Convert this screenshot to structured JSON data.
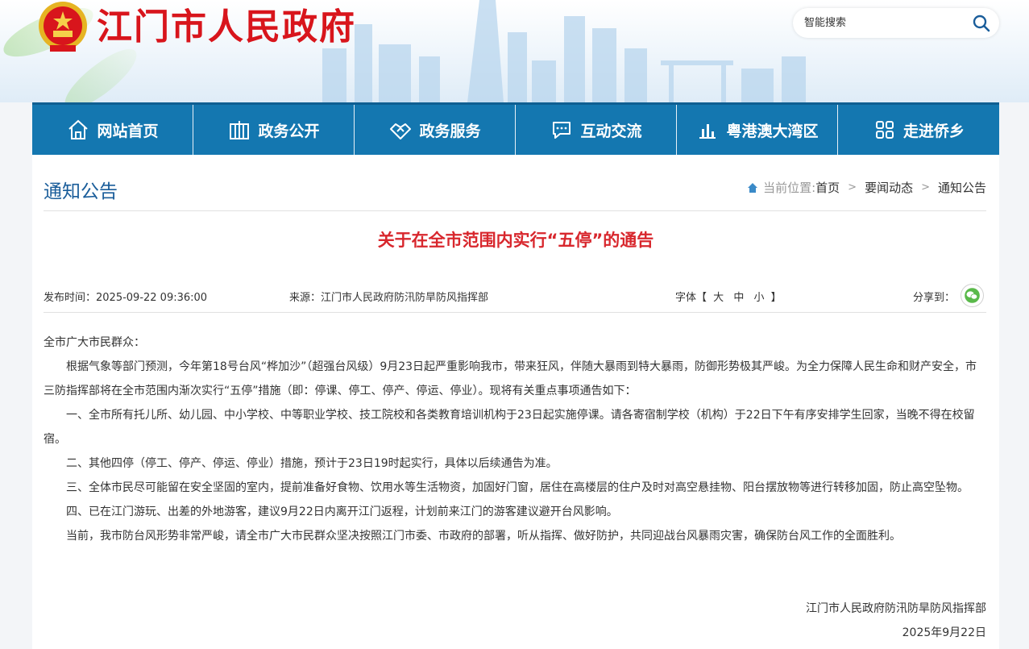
{
  "header": {
    "site_title": "江门市人民政府",
    "search_placeholder": "智能搜索"
  },
  "nav": {
    "items": [
      {
        "label": "网站首页",
        "icon": "home-icon"
      },
      {
        "label": "政务公开",
        "icon": "building-icon"
      },
      {
        "label": "政务服务",
        "icon": "handshake-icon"
      },
      {
        "label": "互动交流",
        "icon": "chat-icon"
      },
      {
        "label": "粤港澳大湾区",
        "icon": "bar-chart-icon"
      },
      {
        "label": "走进侨乡",
        "icon": "grid-icon"
      }
    ]
  },
  "page": {
    "section_title": "通知公告",
    "breadcrumb": {
      "label": "当前位置:",
      "items": [
        "首页",
        "要闻动态",
        "通知公告"
      ],
      "separator": ">"
    }
  },
  "article": {
    "title": "关于在全市范围内实行“五停”的通告",
    "publish_time": "发布时间：2025-09-22 09:36:00",
    "source": "来源：江门市人民政府防汛防旱防风指挥部",
    "font_label": "字体【",
    "font_sizes": [
      "大",
      "中",
      "小"
    ],
    "font_close": "】",
    "share_label": "分享到：",
    "paragraphs": [
      "全市广大市民群众：",
      "根据气象等部门预测，今年第18号台风“桦加沙”（超强台风级）9月23日起严重影响我市，带来狂风，伴随大暴雨到特大暴雨，防御形势极其严峻。为全力保障人民生命和财产安全，市三防指挥部将在全市范围内渐次实行“五停”措施（即：停课、停工、停产、停运、停业）。现将有关重点事项通告如下：",
      "一、全市所有托儿所、幼儿园、中小学校、中等职业学校、技工院校和各类教育培训机构于23日起实施停课。请各寄宿制学校（机构）于22日下午有序安排学生回家，当晚不得在校留宿。",
      "二、其他四停（停工、停产、停运、停业）措施，预计于23日19时起实行，具体以后续通告为准。",
      "三、全体市民尽可能留在安全坚固的室内，提前准备好食物、饮用水等生活物资，加固好门窗，居住在高楼层的住户及时对高空悬挂物、阳台摆放物等进行转移加固，防止高空坠物。",
      "四、已在江门游玩、出差的外地游客，建议9月22日内离开江门返程，计划前来江门的游客建议避开台风影响。",
      "当前，我市防台风形势非常严峻，请全市广大市民群众坚决按照江门市委、市政府的部署，听从指挥、做好防护，共同迎战台风暴雨灾害，确保防台风工作的全面胜利。"
    ],
    "signature": "江门市人民政府防汛防旱防风指挥部",
    "sign_date": "2025年9月22日"
  },
  "colors": {
    "brand_red": "#d8151c",
    "nav_blue": "#1477b0",
    "title_red": "#d8272d",
    "section_blue": "#1a5d9a"
  }
}
